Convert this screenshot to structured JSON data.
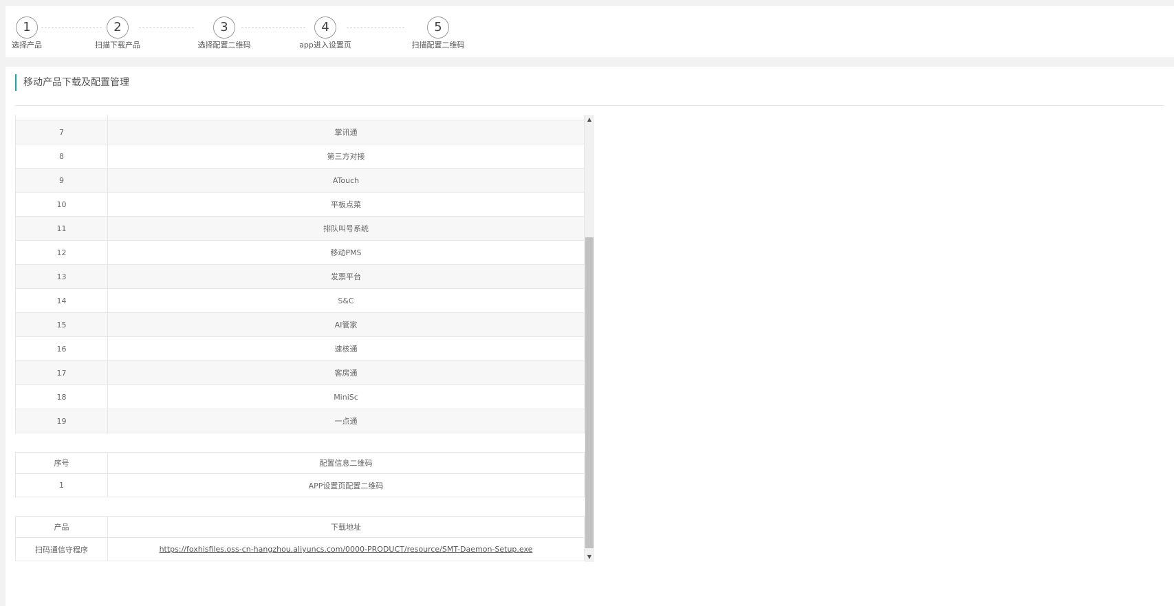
{
  "steps": [
    {
      "number": "1",
      "label": "选择产品"
    },
    {
      "number": "2",
      "label": "扫描下载产品"
    },
    {
      "number": "3",
      "label": "选择配置二维码"
    },
    {
      "number": "4",
      "label": "app进入设置页"
    },
    {
      "number": "5",
      "label": "扫描配置二维码"
    }
  ],
  "panel": {
    "title": "移动产品下载及配置管理"
  },
  "products": [
    {
      "no": "7",
      "name": "掌讯通"
    },
    {
      "no": "8",
      "name": "第三方对接"
    },
    {
      "no": "9",
      "name": "ATouch"
    },
    {
      "no": "10",
      "name": "平板点菜"
    },
    {
      "no": "11",
      "name": "排队叫号系统"
    },
    {
      "no": "12",
      "name": "移动PMS"
    },
    {
      "no": "13",
      "name": "发票平台"
    },
    {
      "no": "14",
      "name": "S&C"
    },
    {
      "no": "15",
      "name": "AI管家"
    },
    {
      "no": "16",
      "name": "速核通"
    },
    {
      "no": "17",
      "name": "客房通"
    },
    {
      "no": "18",
      "name": "MiniSc"
    },
    {
      "no": "19",
      "name": "一点通"
    }
  ],
  "config_table": {
    "headers": [
      "序号",
      "配置信息二维码"
    ],
    "rows": [
      {
        "no": "1",
        "name": "APP设置页配置二维码"
      }
    ]
  },
  "download_table": {
    "headers": [
      "产品",
      "下载地址"
    ],
    "rows": [
      {
        "product": "扫码通信守程序",
        "url": "https://foxhisfiles.oss-cn-hangzhou.aliyuncs.com/0000-PRODUCT/resource/SMT-Daemon-Setup.exe"
      }
    ]
  },
  "colors": {
    "accent": "#1aa5a5"
  },
  "icons": {
    "scroll_up": "triangle-up-icon",
    "scroll_down": "triangle-down-icon"
  }
}
